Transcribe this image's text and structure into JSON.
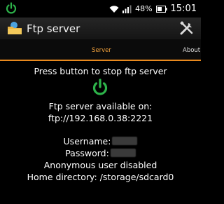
{
  "status_bar": {
    "battery_percent": "48%",
    "time": "15:01",
    "icons": [
      "power-notification-icon",
      "wifi-icon",
      "signal-icon",
      "battery-icon"
    ]
  },
  "action_bar": {
    "title": "Ftp server",
    "icons": [
      "app-folder-icon",
      "settings-tools-icon"
    ]
  },
  "tabs": [
    {
      "label": "Server",
      "selected": true
    },
    {
      "label": "About",
      "selected": false
    }
  ],
  "server": {
    "stop_instruction": "Press button to stop ftp server",
    "available_label": "Ftp server available on:",
    "url": "ftp://192.168.0.38:2221",
    "username_label": "Username:",
    "password_label": "Password:",
    "anonymous_status": "Anonymous user disabled",
    "home_directory": "Home directory: /storage/sdcard0"
  },
  "colors": {
    "accent": "#e8891e",
    "tab_selected_text": "#f0a03c",
    "power_button": "#2db34a",
    "background": "#000000"
  }
}
